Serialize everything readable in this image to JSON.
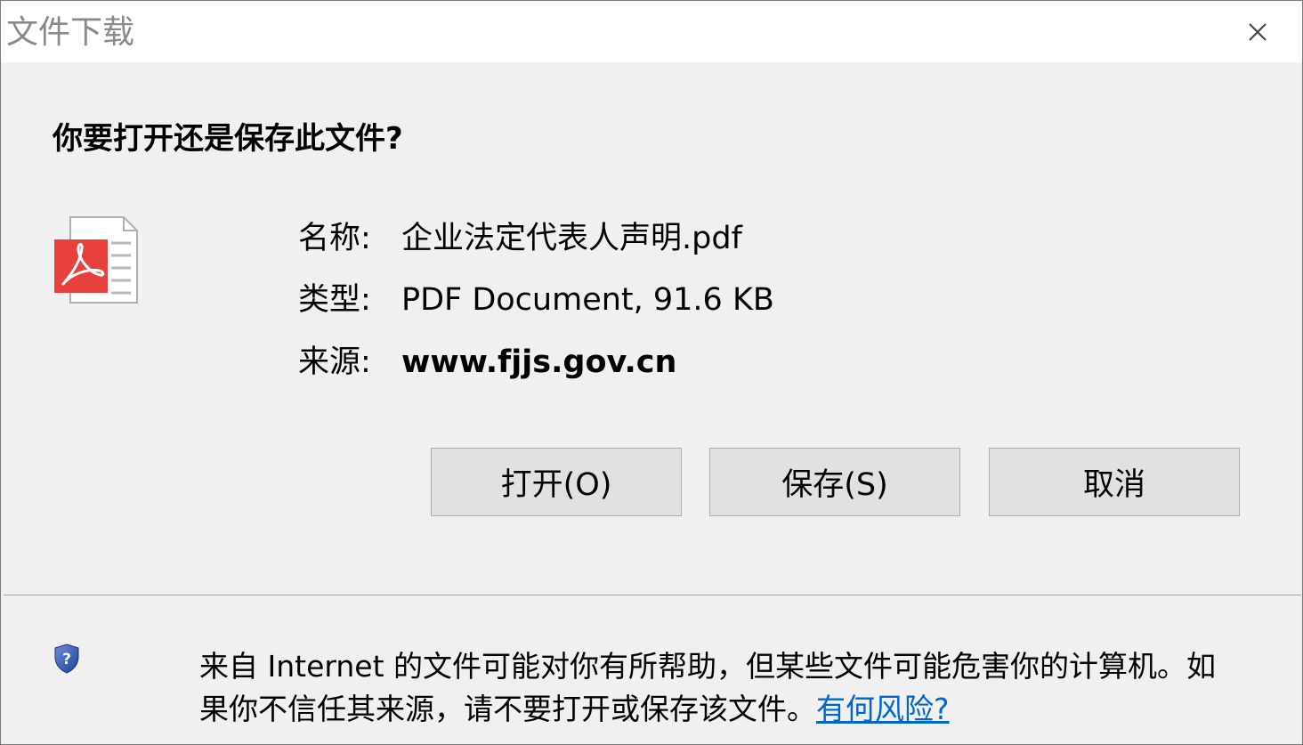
{
  "window": {
    "title": "文件下载",
    "close_icon": "close-icon"
  },
  "dialog": {
    "heading": "你要打开还是保存此文件?",
    "file_icon": "pdf-file-icon",
    "fields": {
      "name_label": "名称:",
      "name_value": "企业法定代表人声明.pdf",
      "type_label": "类型:",
      "type_value": "PDF Document, 91.6 KB",
      "source_label": "来源:",
      "source_value": "www.fjjs.gov.cn"
    },
    "buttons": {
      "open": "打开(O)",
      "save": "保存(S)",
      "cancel": "取消"
    }
  },
  "footer": {
    "shield_icon": "shield-question-icon",
    "warning_text": "来自 Internet 的文件可能对你有所帮助，但某些文件可能危害你的计算机。如果你不信任其来源，请不要打开或保存该文件。",
    "risk_link": "有何风险?"
  },
  "colors": {
    "dialog_bg": "#f0f0f0",
    "titlebar_bg": "#ffffff",
    "button_bg": "#e1e1e1",
    "link": "#0066cc",
    "pdf_red": "#e8403d"
  }
}
